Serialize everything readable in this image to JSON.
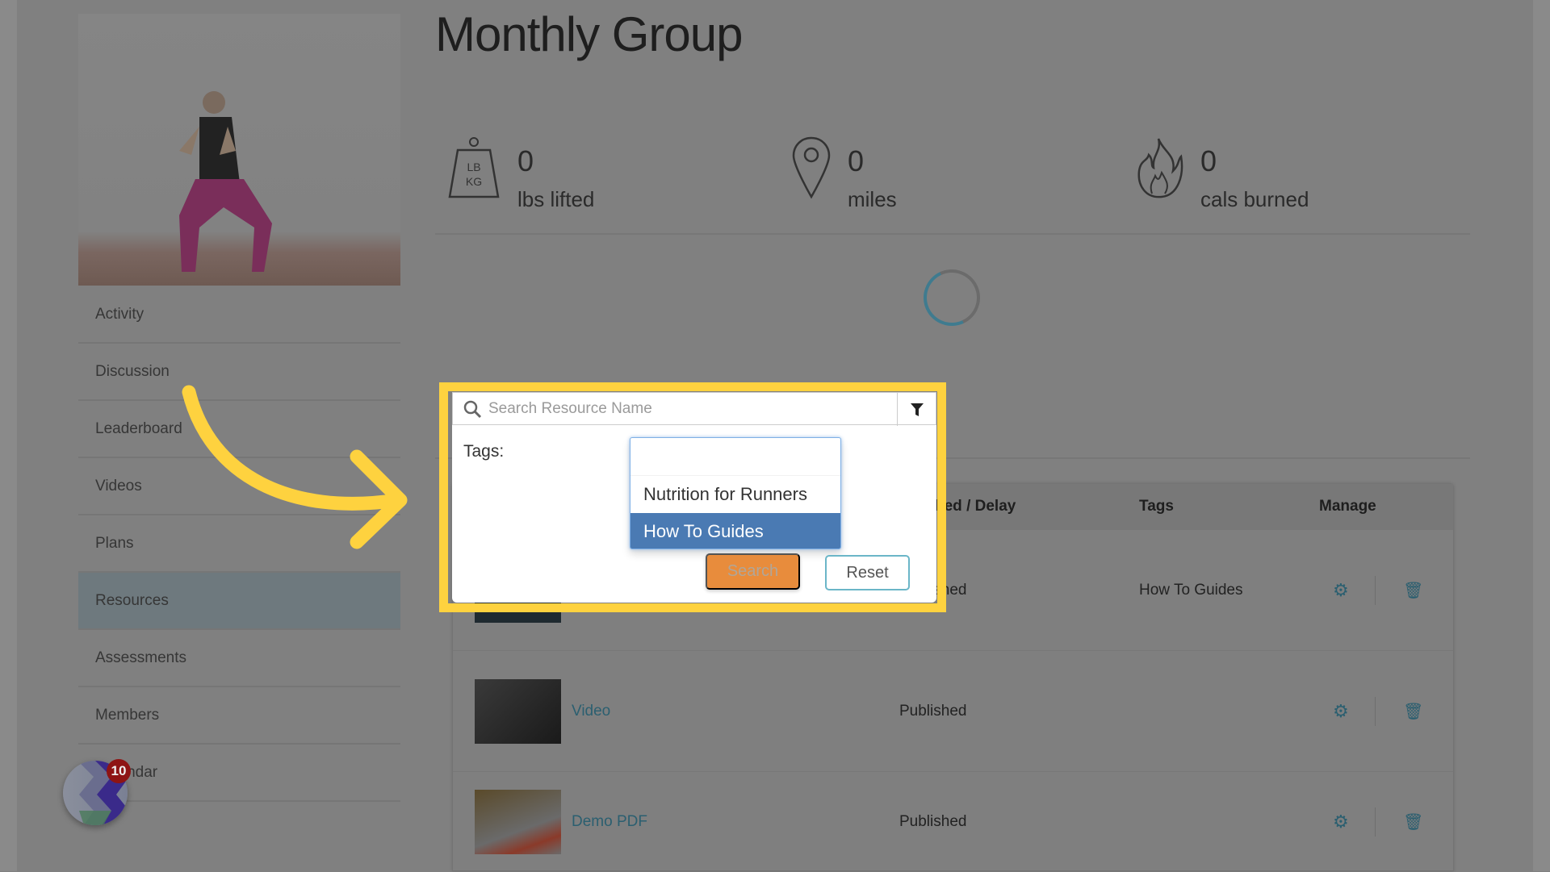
{
  "group": {
    "title": "Monthly Group"
  },
  "sidebar": {
    "items": [
      {
        "label": "Activity"
      },
      {
        "label": "Discussion"
      },
      {
        "label": "Leaderboard"
      },
      {
        "label": "Videos"
      },
      {
        "label": "Plans"
      },
      {
        "label": "Resources",
        "active": true
      },
      {
        "label": "Assessments"
      },
      {
        "label": "Members"
      },
      {
        "label": "Calendar"
      }
    ]
  },
  "stats": [
    {
      "icon": "weight-icon",
      "icon_text_top": "LB",
      "icon_text_bottom": "KG",
      "value": "0",
      "label": "lbs lifted"
    },
    {
      "icon": "map-pin-icon",
      "value": "0",
      "label": "miles"
    },
    {
      "icon": "flame-icon",
      "value": "0",
      "label": "cals burned"
    }
  ],
  "table": {
    "headers": {
      "status": "Published / Delay",
      "tags": "Tags",
      "manage": "Manage"
    },
    "rows": [
      {
        "name": "",
        "status": "Published",
        "tags": "How To Guides"
      },
      {
        "name": "Video",
        "status": "Published",
        "tags": ""
      },
      {
        "name": "Demo PDF",
        "status": "Published",
        "tags": ""
      }
    ]
  },
  "filter_popup": {
    "search_placeholder": "Search Resource Name",
    "tags_label": "Tags:",
    "tag_options": [
      "Nutrition for Runners",
      "How To Guides"
    ],
    "selected_tag": "How To Guides",
    "search_button": "Search",
    "reset_button": "Reset"
  },
  "notification": {
    "count": "10"
  },
  "colors": {
    "highlight": "#fed23f",
    "selected_option": "#4a7ab3",
    "search_button": "#e88c3c",
    "reset_border": "#6bb6c8",
    "link": "#2b5f70"
  }
}
